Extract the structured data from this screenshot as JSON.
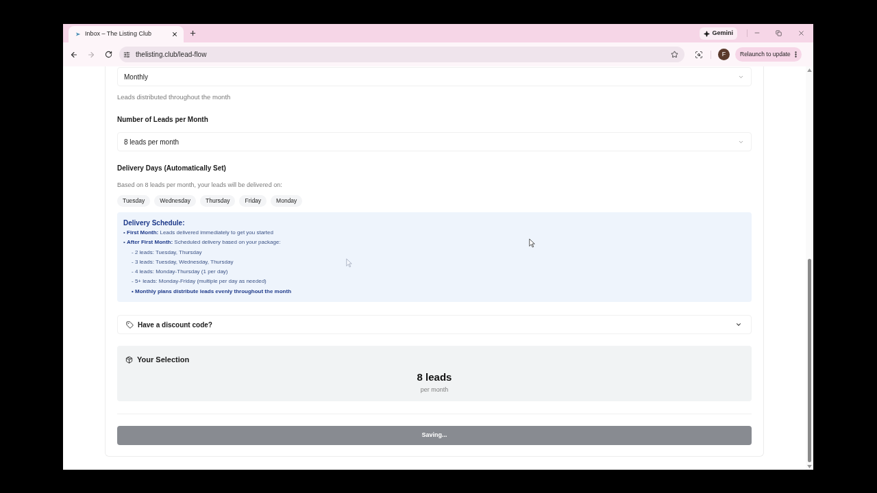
{
  "browser": {
    "tabs": [
      {
        "title": "Inbox – The Listing Club",
        "selected": true
      }
    ],
    "gemini_label": "Gemini",
    "url": "thelisting.club/lead-flow",
    "profile_initial": "F",
    "relaunch_label": "Relaunch to update"
  },
  "form": {
    "frequency_select": {
      "value": "Monthly"
    },
    "frequency_hint": "Leads distributed throughout the month",
    "leads_label": "Number of Leads per Month",
    "leads_select": {
      "value": "8 leads per month"
    },
    "days_label": "Delivery Days (Automatically Set)",
    "days_hint": "Based on 8 leads per month, your leads will be delivered on:",
    "days": [
      "Tuesday",
      "Wednesday",
      "Thursday",
      "Friday",
      "Monday"
    ],
    "schedule": {
      "title": "Delivery Schedule:",
      "lines": [
        {
          "kind": "item",
          "text": "• **First Month:** Leads delivered immediately to get you started"
        },
        {
          "kind": "item",
          "text": "• **After First Month:** Scheduled delivery based on your package:"
        },
        {
          "kind": "sub",
          "text": "- 2 leads: Tuesday, Thursday"
        },
        {
          "kind": "sub",
          "text": "- 3 leads: Tuesday, Wednesday, Thursday"
        },
        {
          "kind": "sub",
          "text": "- 4 leads: Monday-Thursday (1 per day)"
        },
        {
          "kind": "sub",
          "text": "- 5+ leads: Monday-Friday (multiple per day as needed)"
        },
        {
          "kind": "note",
          "text": "• Monthly plans distribute leads evenly throughout the month"
        }
      ]
    },
    "discount": {
      "label": "Have a discount code?",
      "expanded": false
    },
    "selection": {
      "title": "Your Selection",
      "value": "8 leads",
      "unit": "per month"
    },
    "save_button": {
      "label": "Saving...",
      "disabled": true
    }
  }
}
